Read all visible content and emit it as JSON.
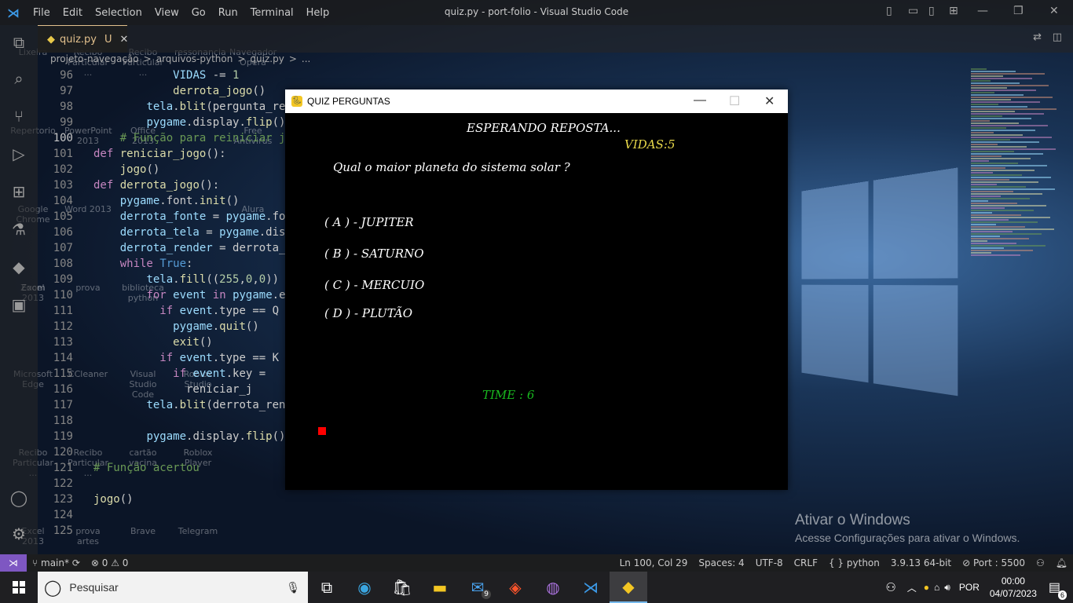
{
  "vscode": {
    "menu": [
      "File",
      "Edit",
      "Selection",
      "View",
      "Go",
      "Run",
      "Terminal",
      "Help"
    ],
    "window_title": "quiz.py - port-folio - Visual Studio Code",
    "tab": {
      "name": "quiz.py",
      "status": "U"
    },
    "breadcrumb": [
      "projeto-navegação",
      ">",
      "arquivos-python",
      ">",
      "quiz.py",
      ">",
      "..."
    ],
    "lines": [
      {
        "n": "96",
        "code": "            VIDAS -= 1"
      },
      {
        "n": "97",
        "code": "            derrota_jogo()"
      },
      {
        "n": "98",
        "code": "        tela.blit(pergunta_ren"
      },
      {
        "n": "99",
        "code": "        pygame.display.flip()"
      },
      {
        "n": "100",
        "code": "    # Função para reiniciar jogo"
      },
      {
        "n": "101",
        "code": "def reniciar_jogo():"
      },
      {
        "n": "102",
        "code": "    jogo()"
      },
      {
        "n": "103",
        "code": "def derrota_jogo():"
      },
      {
        "n": "104",
        "code": "    pygame.font.init()"
      },
      {
        "n": "105",
        "code": "    derrota_fonte = pygame.fon"
      },
      {
        "n": "106",
        "code": "    derrota_tela = pygame.disp"
      },
      {
        "n": "107",
        "code": "    derrota_render = derrota_f"
      },
      {
        "n": "108",
        "code": "    while True:"
      },
      {
        "n": "109",
        "code": "        tela.fill((255,0,0))"
      },
      {
        "n": "110",
        "code": "        for event in pygame.eve"
      },
      {
        "n": "111",
        "code": "          if event.type == Q"
      },
      {
        "n": "112",
        "code": "            pygame.quit()"
      },
      {
        "n": "113",
        "code": "            exit()"
      },
      {
        "n": "114",
        "code": "          if event.type == K"
      },
      {
        "n": "115",
        "code": "            if event.key ="
      },
      {
        "n": "116",
        "code": "              reniciar_j"
      },
      {
        "n": "117",
        "code": "        tela.blit(derrota_rend"
      },
      {
        "n": "118",
        "code": ""
      },
      {
        "n": "119",
        "code": "        pygame.display.flip()"
      },
      {
        "n": "120",
        "code": ""
      },
      {
        "n": "121",
        "code": "# Função acertou"
      },
      {
        "n": "122",
        "code": ""
      },
      {
        "n": "123",
        "code": "jogo()"
      },
      {
        "n": "124",
        "code": ""
      },
      {
        "n": "125",
        "code": ""
      }
    ],
    "active_line": "100",
    "status": {
      "branch": "main*",
      "errors": "0",
      "warnings": "0",
      "position": "Ln 100, Col 29",
      "spaces": "Spaces: 4",
      "encoding": "UTF-8",
      "eol": "CRLF",
      "language": "python",
      "interpreter": "3.9.13 64-bit",
      "port": "Port : 5500"
    }
  },
  "desktop_icons": [
    "Lixeira",
    "Recibo Particular ...",
    "Recibo Particular ...",
    "ressonancia",
    "Navegador Opera",
    "Repertorio",
    "PowerPoint 2013",
    "Office 2013",
    "Free Antivirus",
    "Google Chrome",
    "Word 2013",
    "Excel 2013",
    "Alura",
    "Zoom",
    "prova",
    "biblioteca python",
    "Microsoft Edge",
    "CCleaner",
    "Visual Studio Code",
    "Roblox Studio",
    "Recibo Particular ...",
    "Recibo Particular ...",
    "cartão vacina",
    "Roblox Player",
    "Excel 2013",
    "prova artes",
    "Brave",
    "Telegram"
  ],
  "activation": {
    "title": "Ativar o Windows",
    "subtitle": "Acesse Configurações para ativar o Windows."
  },
  "game": {
    "title": "QUIZ PERGUNTAS",
    "status": "ESPERANDO REPOSTA...",
    "lives": "VIDAS:5",
    "question": "Qual o maior planeta do sistema solar ?",
    "options": [
      "( A ) - JUPITER",
      "( B ) - SATURNO",
      "( C ) - MERCUIO",
      "( D ) - PLUTÃO"
    ],
    "timer": "TIME : 6",
    "colors": {
      "lives": "#e8d84a",
      "timer": "#19b81f",
      "square": "#ff0000"
    }
  },
  "taskbar": {
    "search_placeholder": "Pesquisar",
    "mail_badge": "9",
    "language": "POR",
    "time": "00:00",
    "date": "04/07/2023",
    "notifications": "6"
  }
}
